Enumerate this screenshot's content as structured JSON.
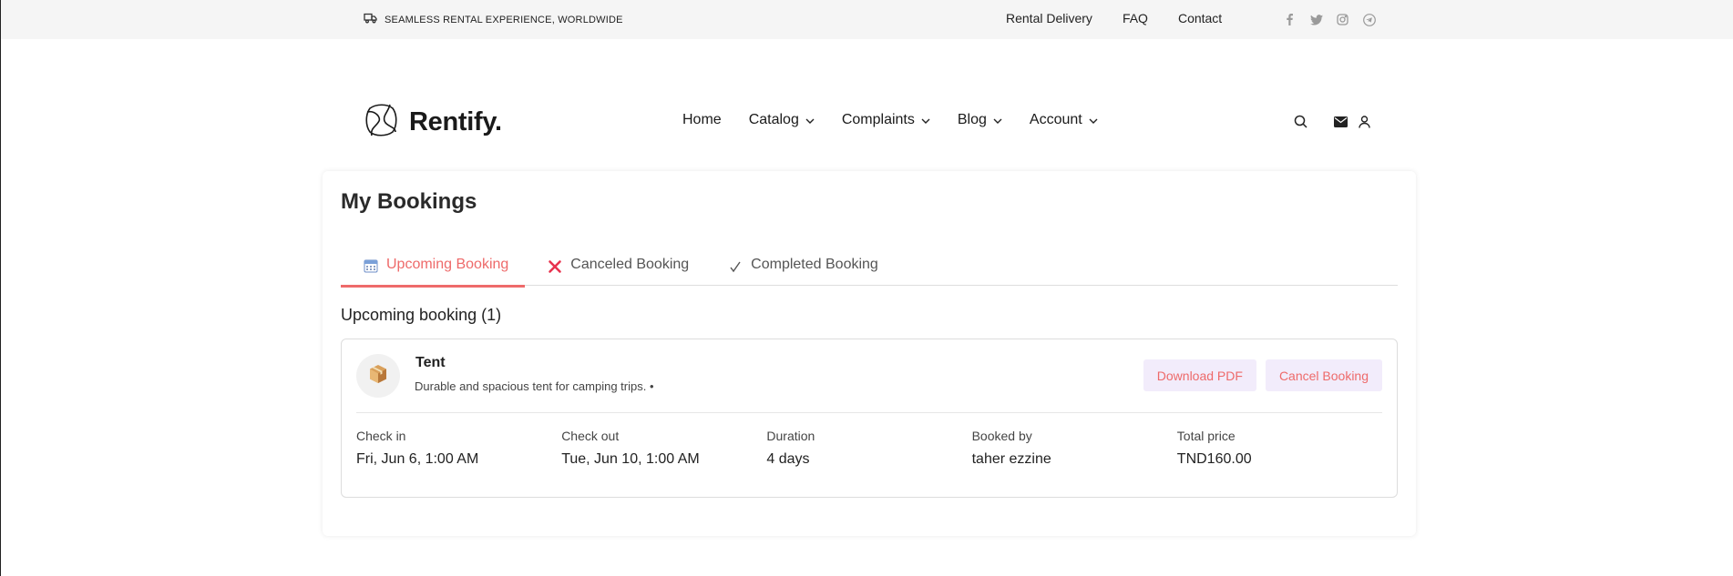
{
  "topbar": {
    "tagline": "SEAMLESS RENTAL EXPERIENCE, WORLDWIDE",
    "links": [
      "Rental Delivery",
      "FAQ",
      "Contact"
    ],
    "social_icons": [
      "facebook-icon",
      "twitter-icon",
      "instagram-icon",
      "telegram-icon"
    ]
  },
  "header": {
    "brand": "Rentify.",
    "nav": [
      {
        "label": "Home",
        "dropdown": false
      },
      {
        "label": "Catalog",
        "dropdown": true
      },
      {
        "label": "Complaints",
        "dropdown": true
      },
      {
        "label": "Blog",
        "dropdown": true
      },
      {
        "label": "Account",
        "dropdown": true
      }
    ],
    "icons": [
      "search-icon",
      "mail-icon",
      "user-icon"
    ]
  },
  "page": {
    "title": "My Bookings",
    "tabs": [
      {
        "label": "Upcoming Booking",
        "icon": "calendar-icon",
        "active": true
      },
      {
        "label": "Canceled Booking",
        "icon": "cross-icon",
        "active": false
      },
      {
        "label": "Completed Booking",
        "icon": "checkmark-icon",
        "active": false
      }
    ],
    "subheading": "Upcoming booking (1)"
  },
  "booking": {
    "name": "Tent",
    "description": "Durable and spacious tent for camping trips. •",
    "actions": {
      "download": "Download PDF",
      "cancel": "Cancel Booking"
    },
    "details": {
      "checkin_label": "Check in",
      "checkin_value": "Fri, Jun 6, 1:00 AM",
      "checkout_label": "Check out",
      "checkout_value": "Tue, Jun 10, 1:00 AM",
      "duration_label": "Duration",
      "duration_value": "4 days",
      "bookedby_label": "Booked by",
      "bookedby_value": "taher ezzine",
      "price_label": "Total price",
      "price_value": "TND160.00"
    }
  },
  "colors": {
    "accent": "#ee6a6a",
    "button_bg": "#f2ecfb",
    "topbar_bg": "#f5f5f5"
  }
}
